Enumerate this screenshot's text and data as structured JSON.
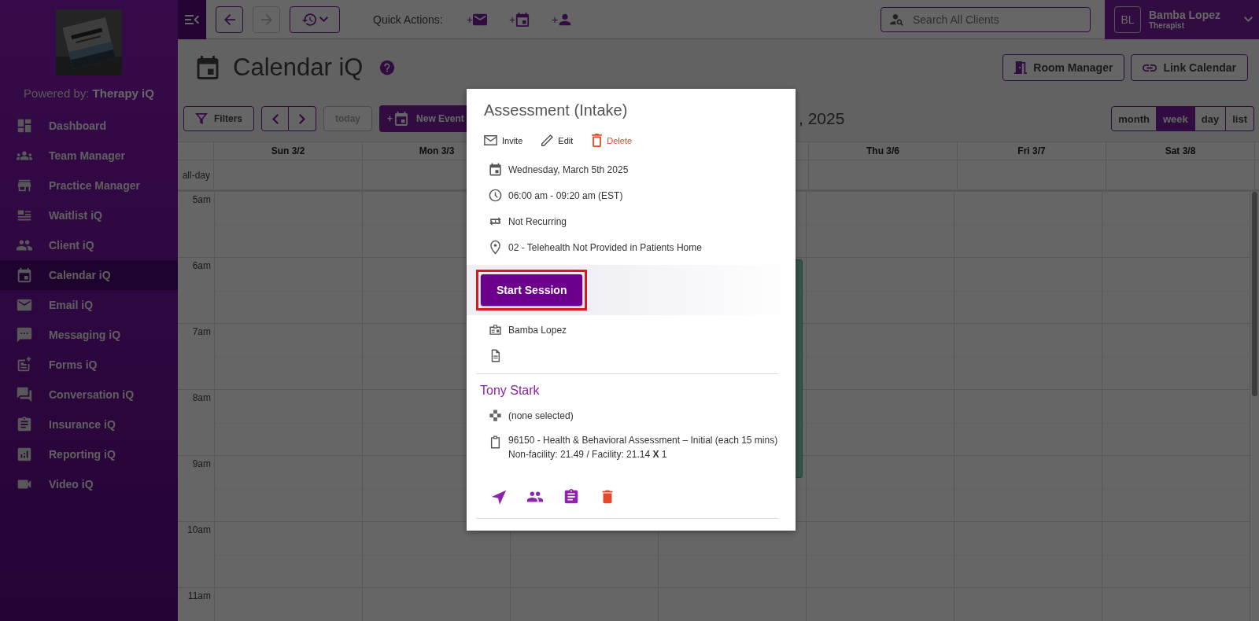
{
  "sidebar": {
    "powered_by": "Powered by: **Therapy iQ**",
    "items": [
      {
        "label": "Dashboard",
        "selected": false
      },
      {
        "label": "Team Manager",
        "selected": false
      },
      {
        "label": "Practice Manager",
        "selected": false
      },
      {
        "label": "Waitlist iQ",
        "selected": false
      },
      {
        "label": "Client iQ",
        "selected": false
      },
      {
        "label": "Calendar iQ",
        "selected": true
      },
      {
        "label": "Email iQ",
        "selected": false
      },
      {
        "label": "Messaging iQ",
        "selected": false
      },
      {
        "label": "Forms iQ",
        "selected": false
      },
      {
        "label": "Conversation iQ",
        "selected": false
      },
      {
        "label": "Insurance iQ",
        "selected": false
      },
      {
        "label": "Reporting iQ",
        "selected": false
      },
      {
        "label": "Video iQ",
        "selected": false
      }
    ]
  },
  "top_bar": {
    "forward_disabled": true,
    "quick_actions_label": "Quick Actions:",
    "quick_actions": [
      {
        "kind": "mail",
        "prefix": "+"
      },
      {
        "kind": "calendar",
        "prefix": "+"
      },
      {
        "kind": "person",
        "prefix": "+"
      }
    ],
    "search": {
      "placeholder": "Search All Clients"
    },
    "user": {
      "initials": "BL",
      "name": "Bamba Lopez",
      "role": "Therapist"
    }
  },
  "header": {
    "title": "Calendar iQ",
    "buttons": [
      {
        "kind": "room",
        "label": "Room Manager"
      },
      {
        "kind": "link",
        "label": "Link Calendar"
      }
    ]
  },
  "toolbar": {
    "filters": "Filters",
    "today": {
      "label": "today",
      "disabled": true
    },
    "new_event": {
      "prefix": "+",
      "label": "New Event"
    },
    "title": ", 2025",
    "views": [
      {
        "label": "month",
        "selected": false
      },
      {
        "label": "week",
        "selected": true
      },
      {
        "label": "day",
        "selected": false
      },
      {
        "label": "list",
        "selected": false
      }
    ]
  },
  "calendar": {
    "columns": [
      {
        "label": "Sun 3/2"
      },
      {
        "label": "Mon 3/3"
      },
      {},
      {
        "event": true
      },
      {
        "label": "Thu 3/6"
      },
      {
        "label": "Fri 3/7"
      },
      {
        "label": "Sat 3/8"
      }
    ],
    "all_day_label": "all-day",
    "hours": [
      "5am",
      "6am",
      "7am",
      "8am",
      "9am",
      "10am",
      "11am"
    ]
  },
  "event_popup": {
    "title": "Assessment (Intake)",
    "actions": [
      {
        "kind": "invite",
        "label": "Invite"
      },
      {
        "kind": "edit",
        "label": "Edit"
      },
      {
        "kind": "delete",
        "label": "Delete"
      }
    ],
    "details": [
      {
        "kind": "date",
        "text": "Wednesday, March 5th 2025"
      },
      {
        "kind": "time",
        "text": "06:00 am - 09:20 am (EST)"
      },
      {
        "kind": "recurrence",
        "text": "Not Recurring"
      },
      {
        "kind": "location",
        "text": "02 - Telehealth Not Provided in Patients Home"
      }
    ],
    "start_button": {
      "label": "Start Session",
      "highlighted": true
    },
    "provider": "Bamba Lopez",
    "client": "Tony Stark",
    "service": "(none selected)",
    "code_lines": [
      "96150 - Health & Behavioral Assessment – Initial (each 15 mins)",
      "Non-facility: 21.49 / Facility: 21.14 **X** 1"
    ]
  }
}
